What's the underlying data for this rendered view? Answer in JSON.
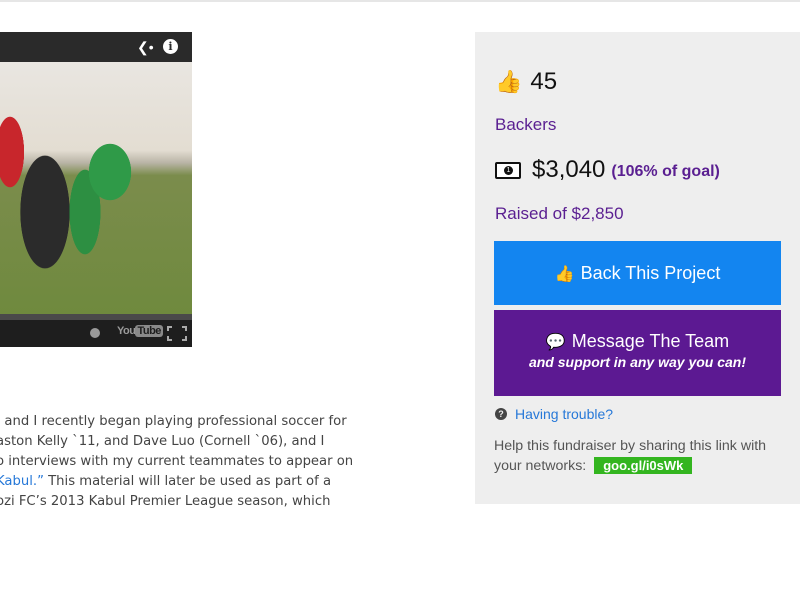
{
  "video": {
    "share_icon": "share-icon",
    "info_icon": "info-icon",
    "info_glyph": "i",
    "watch_later_icon": "clock-icon",
    "youtube_logo": {
      "you": "You",
      "tube": "Tube"
    },
    "fullscreen_icon": "fullscreen-icon"
  },
  "description": {
    "lines": [
      ", and I recently began playing professional soccer for",
      "aston Kelly `11, and Dave Luo (Cornell `06), and I",
      "o interviews with my current teammates to appear on",
      "",
      "ozi FC’s 2013 Kabul Premier League season, which"
    ],
    "line4_link": " Kabul.”",
    "line4_rest": " This material will later be used as part of a"
  },
  "sidebar": {
    "backers": {
      "icon": "thumbs-up-icon",
      "count": "45",
      "label": "Backers"
    },
    "raised": {
      "icon": "money-icon",
      "amount": "$3,040",
      "goal_pct_text": "(106% of goal)",
      "goal_pct": 106,
      "label": "Raised of $2,850"
    },
    "back_button": {
      "icon": "thumbs-up-icon",
      "label": "Back This Project",
      "color": "#1385f0"
    },
    "message_button": {
      "icon": "chat-bubble-icon",
      "label": "Message The Team",
      "sublabel": "and support in any way you can!",
      "color": "#5c1992"
    },
    "trouble": {
      "icon": "question-circle-icon",
      "label": "Having trouble?"
    },
    "share": {
      "text": "Help this fundraiser by sharing this link with your networks:",
      "link": "goo.gl/i0sWk",
      "link_color": "#33b51f"
    }
  },
  "colors": {
    "accent_purple": "#5a1f91",
    "link_blue": "#2678d8",
    "panel_bg": "#eeeeee"
  }
}
